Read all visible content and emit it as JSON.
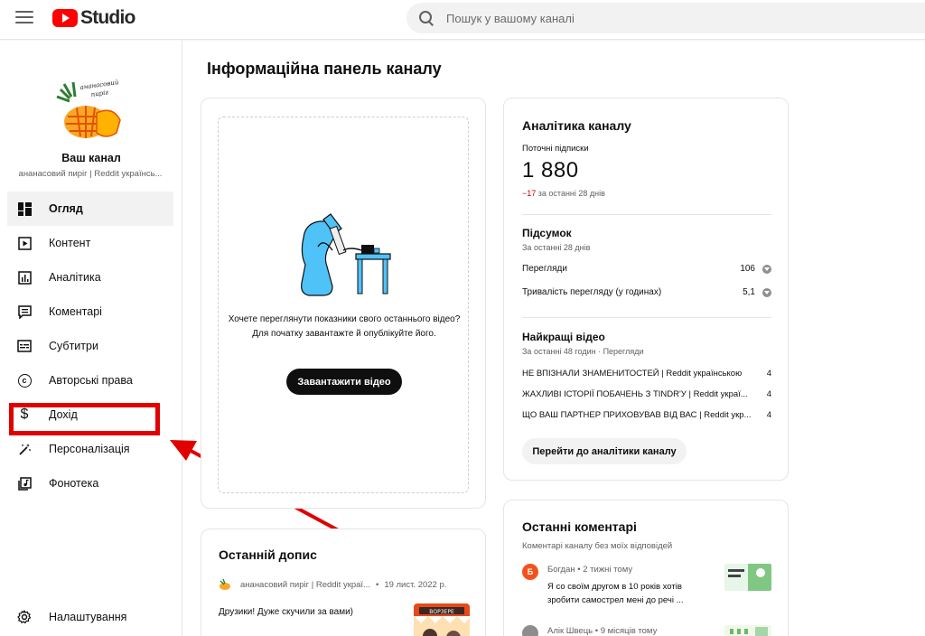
{
  "header": {
    "logo_text": "Studio",
    "search_placeholder": "Пошук у вашому каналі"
  },
  "sidebar": {
    "avatar_text": "ананасовий пиріг",
    "channel_label": "Ваш канал",
    "channel_name": "ананасовий пиріг | Reddit українсь...",
    "items": [
      {
        "label": "Огляд",
        "icon": "dashboard-icon",
        "active": true
      },
      {
        "label": "Контент",
        "icon": "content-icon"
      },
      {
        "label": "Аналітика",
        "icon": "analytics-icon"
      },
      {
        "label": "Коментарі",
        "icon": "comments-icon"
      },
      {
        "label": "Субтитри",
        "icon": "subtitles-icon"
      },
      {
        "label": "Авторські права",
        "icon": "copyright-icon"
      },
      {
        "label": "Дохід",
        "icon": "dollar-icon"
      },
      {
        "label": "Персоналізація",
        "icon": "magic-wand-icon"
      },
      {
        "label": "Фонотека",
        "icon": "audio-library-icon"
      }
    ],
    "settings_label": "Налаштування"
  },
  "main": {
    "title": "Інформаційна панель каналу",
    "upload": {
      "text_line1": "Хочете переглянути показники свого останнього відео?",
      "text_line2": "Для початку завантажте й опублікуйте його.",
      "button": "Завантажити відео"
    },
    "post": {
      "title": "Останній допис",
      "author": "ананасовий пиріг | Reddit украї...",
      "date": "19 лист. 2022 р.",
      "text": "Друзики! Дуже скучили за вами)",
      "thumb_text": "ВОРЗЕРЕ"
    },
    "analytics": {
      "title": "Аналітика каналу",
      "subs_label": "Поточні підписки",
      "subs_value": "1 880",
      "subs_change": "−17",
      "subs_change_period": " за останні 28 днів",
      "summary_title": "Підсумок",
      "summary_period": "За останні 28 днів",
      "metrics": [
        {
          "label": "Перегляди",
          "value": "106"
        },
        {
          "label": "Тривалість перегляду (у годинах)",
          "value": "5,1"
        }
      ],
      "top_title": "Найкращі відео",
      "top_period": "За останні 48 годин · Перегляди",
      "top_videos": [
        {
          "title": "НЕ ВПІЗНАЛИ ЗНАМЕНИТОСТЕЙ | Reddit українською",
          "views": "4"
        },
        {
          "title": "ЖАХЛИВІ ІСТОРІЇ ПОБАЧЕНЬ З TINDR'У | Reddit украї...",
          "views": "4"
        },
        {
          "title": "ЩО ВАШ ПАРТНЕР ПРИХОВУВАВ ВІД ВАС | Reddit укр...",
          "views": "4"
        }
      ],
      "button": "Перейти до аналітики каналу"
    },
    "comments": {
      "title": "Останні коментарі",
      "caption": "Коментарі каналу без моїх відповідей",
      "items": [
        {
          "initial": "Б",
          "author": "Богдан • 2 тижні тому",
          "text": "Я со своїм другом в 10 років хотів зробити самострел мені до речі ...",
          "color": "#f4511e"
        },
        {
          "initial": "",
          "author": "Алік Швець • 9 місяців тому",
          "text": "",
          "color": "#8d8d8d"
        }
      ]
    }
  },
  "colors": {
    "accent_red": "#ff0000",
    "highlight": "#e00000",
    "negative": "#cc0000",
    "illustration_blue": "#4fc3f7"
  }
}
